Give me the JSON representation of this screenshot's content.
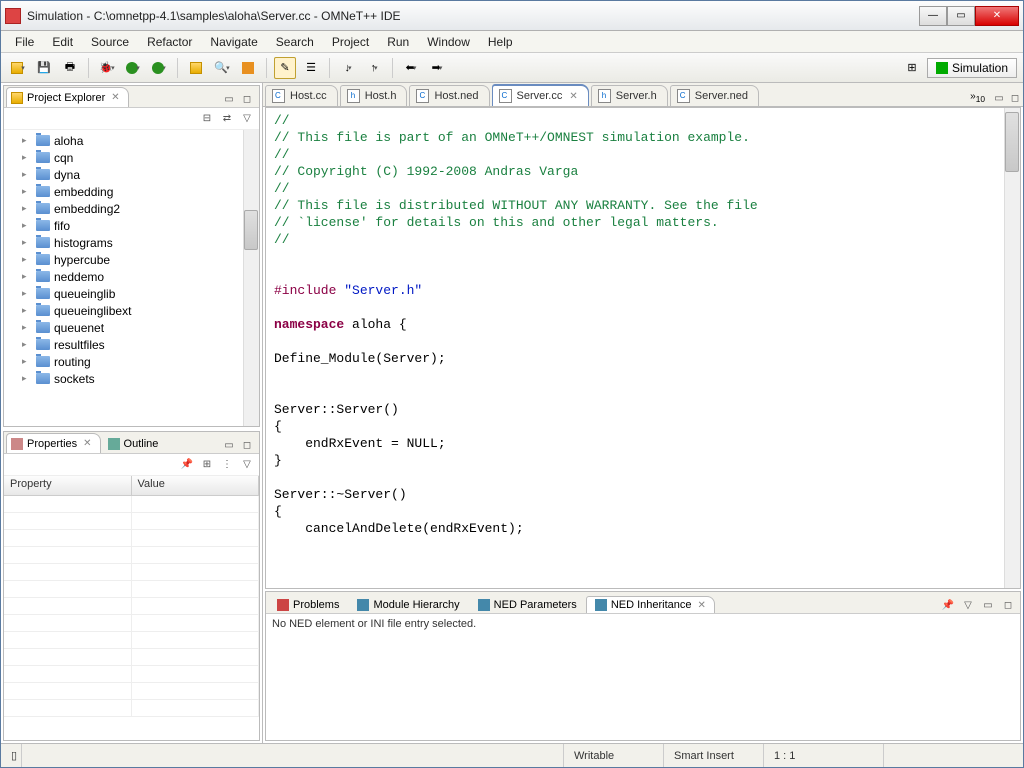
{
  "window": {
    "title": "Simulation - C:\\omnetpp-4.1\\samples\\aloha\\Server.cc - OMNeT++ IDE"
  },
  "menu": [
    "File",
    "Edit",
    "Source",
    "Refactor",
    "Navigate",
    "Search",
    "Project",
    "Run",
    "Window",
    "Help"
  ],
  "perspective": {
    "label": "Simulation"
  },
  "projectExplorer": {
    "title": "Project Explorer",
    "items": [
      "aloha",
      "cqn",
      "dyna",
      "embedding",
      "embedding2",
      "fifo",
      "histograms",
      "hypercube",
      "neddemo",
      "queueinglib",
      "queueinglibext",
      "queuenet",
      "resultfiles",
      "routing",
      "sockets"
    ]
  },
  "propertiesView": {
    "title": "Properties",
    "col1": "Property",
    "col2": "Value"
  },
  "outlineView": {
    "title": "Outline"
  },
  "editorTabs": {
    "tabs": [
      "Host.cc",
      "Host.h",
      "Host.ned",
      "Server.cc",
      "Server.h",
      "Server.ned"
    ],
    "activeIndex": 3,
    "overflow": "10"
  },
  "code": {
    "l1": "//",
    "l2": "// This file is part of an OMNeT++/OMNEST simulation example.",
    "l3": "//",
    "l4": "// Copyright (C) 1992-2008 Andras Varga",
    "l5": "//",
    "l6": "// This file is distributed WITHOUT ANY WARRANTY. See the file",
    "l7": "// `license' for details on this and other legal matters.",
    "l8": "//",
    "includeKw": "#include ",
    "includeStr": "\"Server.h\"",
    "nsKw": "namespace",
    "nsRest": " aloha {",
    "defmod": "Define_Module(Server);",
    "ctorSig": "Server::Server()",
    "lbrace": "{",
    "ctorBody": "    endRxEvent = NULL;",
    "rbrace": "}",
    "dtorSig": "Server::~Server()",
    "dtorBody": "    cancelAndDelete(endRxEvent);"
  },
  "bottomTabs": {
    "tabs": [
      "Problems",
      "Module Hierarchy",
      "NED Parameters",
      "NED Inheritance"
    ],
    "activeIndex": 3,
    "message": "No NED element or INI file entry selected."
  },
  "status": {
    "writable": "Writable",
    "insert": "Smart Insert",
    "pos": "1 : 1"
  }
}
